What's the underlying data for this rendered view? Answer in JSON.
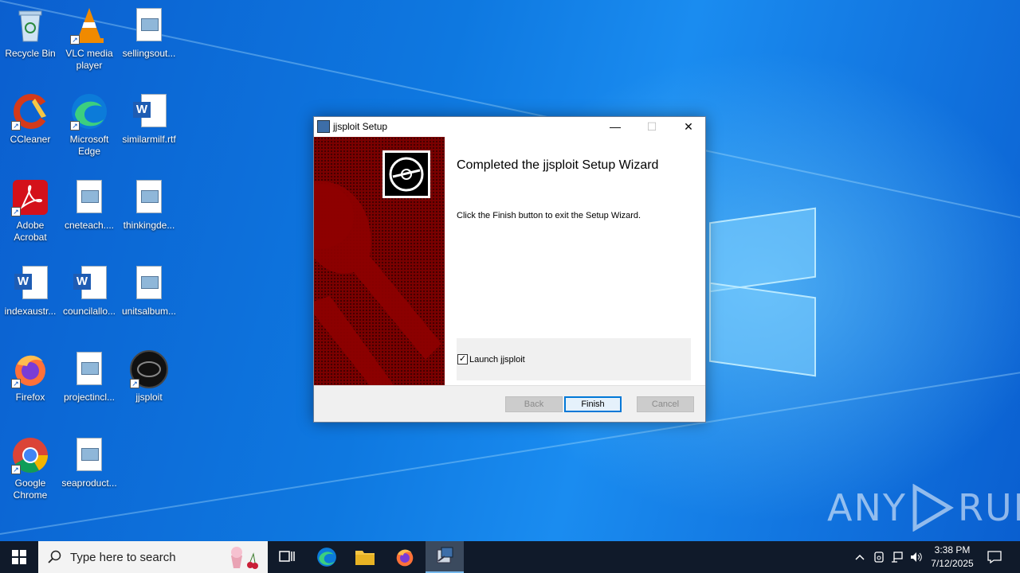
{
  "desktop": {
    "icons": [
      {
        "label": "Recycle Bin"
      },
      {
        "label": "VLC media player"
      },
      {
        "label": "sellingsout..."
      },
      {
        "label": "CCleaner"
      },
      {
        "label": "Microsoft Edge"
      },
      {
        "label": "similarmilf.rtf"
      },
      {
        "label": "Adobe Acrobat"
      },
      {
        "label": "cneteach...."
      },
      {
        "label": "thinkingde..."
      },
      {
        "label": "indexaustr..."
      },
      {
        "label": "councilallo..."
      },
      {
        "label": "unitsalbum..."
      },
      {
        "label": "Firefox"
      },
      {
        "label": "projectincl..."
      },
      {
        "label": "jjsploit"
      },
      {
        "label": "Google Chrome"
      },
      {
        "label": "seaproduct..."
      }
    ],
    "watermark": {
      "left": "ANY",
      "right": "RUN"
    }
  },
  "dialog": {
    "title": "jjsploit Setup",
    "heading": "Completed the jjsploit Setup Wizard",
    "body": "Click the Finish button to exit the Setup Wizard.",
    "checkbox_label": "Launch jjsploit",
    "checkbox_checked": true,
    "buttons": {
      "back": "Back",
      "finish": "Finish",
      "cancel": "Cancel"
    },
    "controls": {
      "minimize": "—",
      "maximize": "☐",
      "close": "✕"
    }
  },
  "taskbar": {
    "search_placeholder": "Type here to search",
    "time": "3:38 PM",
    "date": "7/12/2025",
    "pinned": [
      "task-view-icon",
      "edge-icon",
      "file-explorer-icon",
      "firefox-icon",
      "installer-icon"
    ]
  }
}
